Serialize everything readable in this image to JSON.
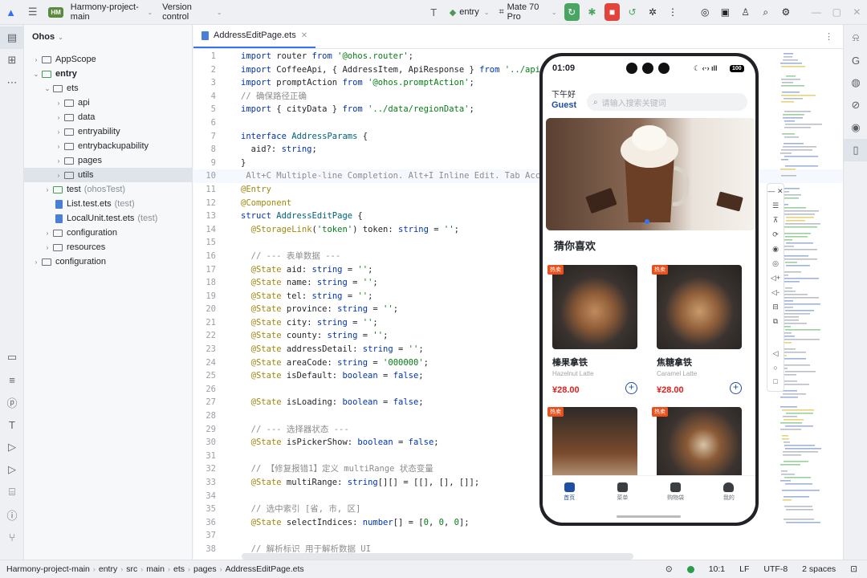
{
  "topbar": {
    "project_badge": "HM",
    "project_name": "Harmony-project-main",
    "vcs": "Version control",
    "run_config": "entry",
    "device": "Mate 70 Pro"
  },
  "project_panel": {
    "title": "Ohos",
    "tree": [
      {
        "label": "AppScope",
        "indent": 0,
        "arrow": "›",
        "kind": "folder"
      },
      {
        "label": "entry",
        "indent": 0,
        "arrow": "⌄",
        "kind": "folder-green",
        "bold": true
      },
      {
        "label": "ets",
        "indent": 1,
        "arrow": "⌄",
        "kind": "folder"
      },
      {
        "label": "api",
        "indent": 2,
        "arrow": "›",
        "kind": "folder"
      },
      {
        "label": "data",
        "indent": 2,
        "arrow": "›",
        "kind": "folder"
      },
      {
        "label": "entryability",
        "indent": 2,
        "arrow": "›",
        "kind": "folder"
      },
      {
        "label": "entrybackupability",
        "indent": 2,
        "arrow": "›",
        "kind": "folder"
      },
      {
        "label": "pages",
        "indent": 2,
        "arrow": "›",
        "kind": "folder"
      },
      {
        "label": "utils",
        "indent": 2,
        "arrow": "›",
        "kind": "folder",
        "selected": true
      },
      {
        "label": "test",
        "extra": "(ohosTest)",
        "indent": 1,
        "arrow": "›",
        "kind": "folder-green"
      },
      {
        "label": "List.test.ets",
        "extra": "(test)",
        "indent": 1,
        "arrow": "",
        "kind": "file"
      },
      {
        "label": "LocalUnit.test.ets",
        "extra": "(test)",
        "indent": 1,
        "arrow": "",
        "kind": "file"
      },
      {
        "label": "configuration",
        "indent": 1,
        "arrow": "›",
        "kind": "folder"
      },
      {
        "label": "resources",
        "indent": 1,
        "arrow": "›",
        "kind": "folder"
      },
      {
        "label": "configuration",
        "indent": 0,
        "arrow": "›",
        "kind": "folder"
      }
    ]
  },
  "editor": {
    "tab_label": "AddressEditPage.ets",
    "lines": [
      {
        "n": "1",
        "html": "<span class='kw'>import</span> router <span class='kw'>from</span> <span class='str'>'@ohos.router'</span>;"
      },
      {
        "n": "2",
        "html": "<span class='kw'>import</span> CoffeeApi, { AddressItem, ApiResponse } <span class='kw'>from</span> <span class='str'>'../api/Co</span>"
      },
      {
        "n": "3",
        "html": "<span class='kw'>import</span> promptAction <span class='kw'>from</span> <span class='str'>'@ohos.promptAction'</span>;"
      },
      {
        "n": "4",
        "html": "<span class='cm'>// 确保路径正确</span>"
      },
      {
        "n": "5",
        "html": "<span class='kw'>import</span> { cityData } <span class='kw'>from</span> <span class='str'>'../data/regionData'</span>;"
      },
      {
        "n": "6",
        "html": ""
      },
      {
        "n": "7",
        "html": "<span class='kw'>interface</span> <span class='fn'>AddressParams</span> {"
      },
      {
        "n": "8",
        "html": "  aid?: <span class='ty'>string</span>;"
      },
      {
        "n": "9",
        "html": "}"
      },
      {
        "n": "10",
        "html": " <span class='hint'>Alt+C Multiple-line Completion. Alt+I Inline Edit. Tab Accept</span>",
        "cur": true
      },
      {
        "n": "11",
        "html": "<span class='dec'>@Entry</span>"
      },
      {
        "n": "12",
        "html": "<span class='dec'>@Component</span>"
      },
      {
        "n": "13",
        "html": "<span class='kw'>struct</span> <span class='fn'>AddressEditPage</span> {"
      },
      {
        "n": "14",
        "html": "  <span class='dec'>@StorageLink</span>(<span class='str'>'token'</span>) token: <span class='ty'>string</span> = <span class='str'>''</span>;"
      },
      {
        "n": "15",
        "html": ""
      },
      {
        "n": "16",
        "html": "  <span class='cm'>// --- 表单数据 ---</span>"
      },
      {
        "n": "17",
        "html": "  <span class='dec'>@State</span> aid: <span class='ty'>string</span> = <span class='str'>''</span>;"
      },
      {
        "n": "18",
        "html": "  <span class='dec'>@State</span> name: <span class='ty'>string</span> = <span class='str'>''</span>;"
      },
      {
        "n": "19",
        "html": "  <span class='dec'>@State</span> tel: <span class='ty'>string</span> = <span class='str'>''</span>;"
      },
      {
        "n": "20",
        "html": "  <span class='dec'>@State</span> province: <span class='ty'>string</span> = <span class='str'>''</span>;"
      },
      {
        "n": "21",
        "html": "  <span class='dec'>@State</span> city: <span class='ty'>string</span> = <span class='str'>''</span>;"
      },
      {
        "n": "22",
        "html": "  <span class='dec'>@State</span> county: <span class='ty'>string</span> = <span class='str'>''</span>;"
      },
      {
        "n": "23",
        "html": "  <span class='dec'>@State</span> addressDetail: <span class='ty'>string</span> = <span class='str'>''</span>;"
      },
      {
        "n": "24",
        "html": "  <span class='dec'>@State</span> areaCode: <span class='ty'>string</span> = <span class='str'>'000000'</span>;"
      },
      {
        "n": "25",
        "html": "  <span class='dec'>@State</span> isDefault: <span class='ty'>boolean</span> = <span class='kw'>false</span>;"
      },
      {
        "n": "26",
        "html": ""
      },
      {
        "n": "27",
        "html": "  <span class='dec'>@State</span> isLoading: <span class='ty'>boolean</span> = <span class='kw'>false</span>;"
      },
      {
        "n": "28",
        "html": ""
      },
      {
        "n": "29",
        "html": "  <span class='cm'>// --- 选择器状态 ---</span>"
      },
      {
        "n": "30",
        "html": "  <span class='dec'>@State</span> isPickerShow: <span class='ty'>boolean</span> = <span class='kw'>false</span>;"
      },
      {
        "n": "31",
        "html": ""
      },
      {
        "n": "32",
        "html": "  <span class='cm'>// 【修复报错1】定义 multiRange 状态变量</span>"
      },
      {
        "n": "33",
        "html": "  <span class='dec'>@State</span> multiRange: <span class='ty'>string</span>[][] = [[], [], []];"
      },
      {
        "n": "34",
        "html": ""
      },
      {
        "n": "35",
        "html": "  <span class='cm'>// 选中索引 [省, 市, 区]</span>"
      },
      {
        "n": "36",
        "html": "  <span class='dec'>@State</span> selectIndices: <span class='ty'>number</span>[] = [<span class='str'>0</span>, <span class='str'>0</span>, <span class='str'>0</span>];"
      },
      {
        "n": "37",
        "html": ""
      },
      {
        "n": "38",
        "html": "  <span class='cm'>// 解析标识 用于解析数据 UI</span>"
      }
    ]
  },
  "phone": {
    "time": "01:09",
    "battery": "100",
    "greet_line1": "下午好",
    "greet_line2": "Guest",
    "search_placeholder": "请输入搜索关键词",
    "section_title": "猜你喜欢",
    "hot_label": "热卖",
    "products": [
      {
        "name": "榛果拿铁",
        "en": "Hazelnut Latte",
        "price": "¥28.00"
      },
      {
        "name": "焦糖拿铁",
        "en": "Caramel Latte",
        "price": "¥28.00"
      }
    ],
    "tabs": [
      "首页",
      "菜单",
      "购物袋",
      "我的"
    ]
  },
  "status": {
    "crumbs": [
      "Harmony-project-main",
      "entry",
      "src",
      "main",
      "ets",
      "pages",
      "AddressEditPage.ets"
    ],
    "position": "10:1",
    "line_sep": "LF",
    "encoding": "UTF-8",
    "indent": "2 spaces"
  }
}
